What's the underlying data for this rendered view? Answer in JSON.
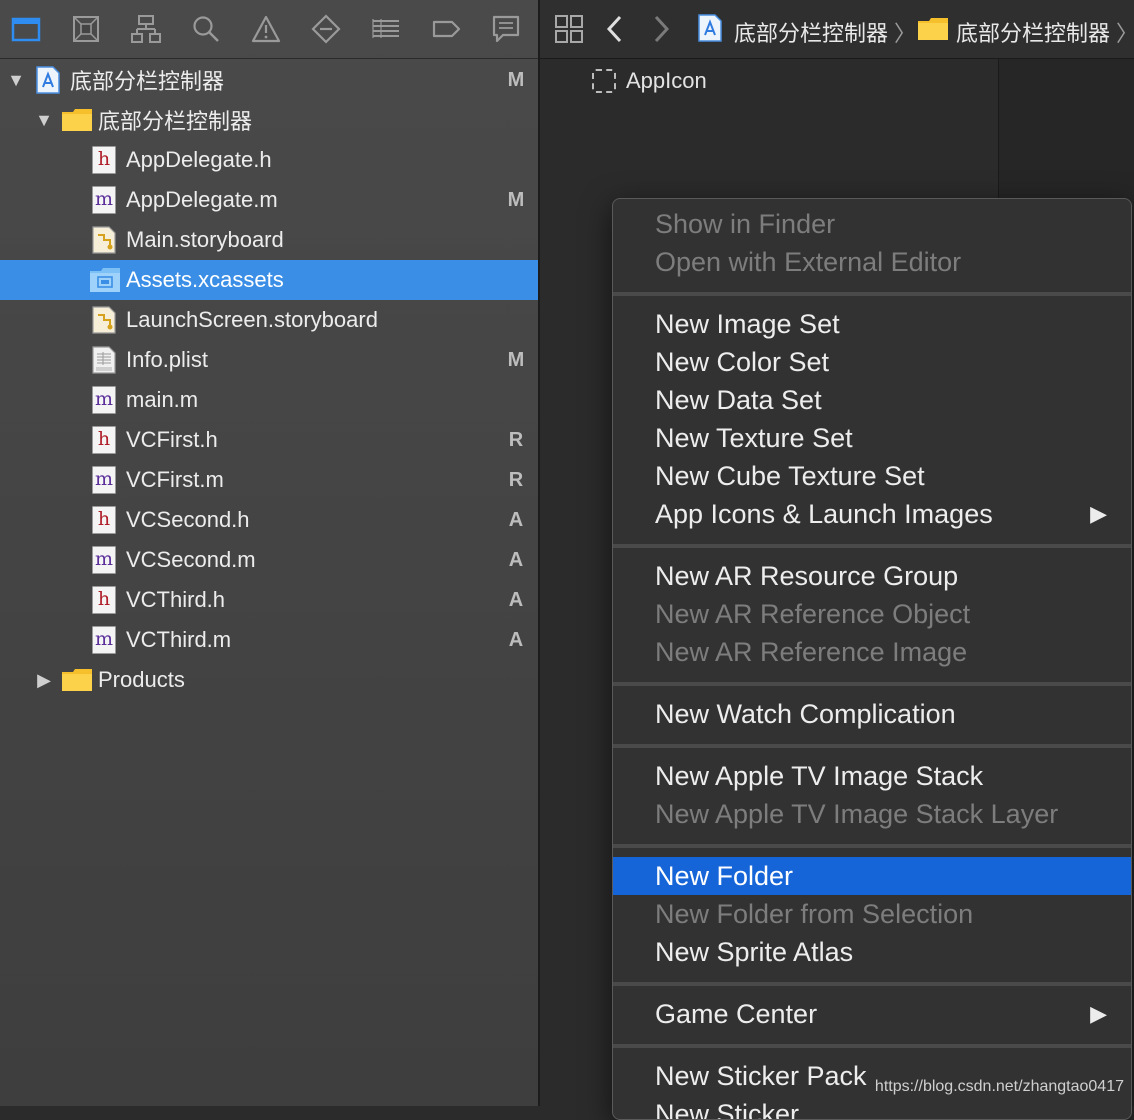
{
  "navigator": {
    "tools": [
      {
        "icon": "folder-icon",
        "active": true
      },
      {
        "icon": "source-control-icon"
      },
      {
        "icon": "hierarchy-icon"
      },
      {
        "icon": "search-icon"
      },
      {
        "icon": "warning-icon"
      },
      {
        "icon": "test-diamond-icon"
      },
      {
        "icon": "debug-list-icon"
      },
      {
        "icon": "breakpoint-icon"
      },
      {
        "icon": "report-icon"
      }
    ],
    "tree": [
      {
        "label": "底部分栏控制器",
        "type": "project",
        "status": "M"
      },
      {
        "label": "底部分栏控制器",
        "type": "group",
        "status": ""
      },
      {
        "label": "AppDelegate.h",
        "type": "h",
        "status": ""
      },
      {
        "label": "AppDelegate.m",
        "type": "m",
        "status": "M"
      },
      {
        "label": "Main.storyboard",
        "type": "storyboard",
        "status": ""
      },
      {
        "label": "Assets.xcassets",
        "type": "xcassets",
        "status": ""
      },
      {
        "label": "LaunchScreen.storyboard",
        "type": "storyboard",
        "status": ""
      },
      {
        "label": "Info.plist",
        "type": "plist",
        "status": "M"
      },
      {
        "label": "main.m",
        "type": "m",
        "status": ""
      },
      {
        "label": "VCFirst.h",
        "type": "h",
        "status": "R"
      },
      {
        "label": "VCFirst.m",
        "type": "m",
        "status": "R"
      },
      {
        "label": "VCSecond.h",
        "type": "h",
        "status": "A"
      },
      {
        "label": "VCSecond.m",
        "type": "m",
        "status": "A"
      },
      {
        "label": "VCThird.h",
        "type": "h",
        "status": "A"
      },
      {
        "label": "VCThird.m",
        "type": "m",
        "status": "A"
      },
      {
        "label": "Products",
        "type": "group",
        "status": ""
      }
    ],
    "selected_label": "Assets.xcassets"
  },
  "jumpbar": {
    "crumb1": "底部分栏控制器",
    "crumb2": "底部分栏控制器",
    "separator": "〉"
  },
  "asset_list": {
    "item": "AppIcon"
  },
  "context_menu": {
    "groups": [
      [
        {
          "label": "Show in Finder",
          "disabled": true
        },
        {
          "label": "Open with External Editor",
          "disabled": true
        }
      ],
      [
        {
          "label": "New Image Set"
        },
        {
          "label": "New Color Set"
        },
        {
          "label": "New Data Set"
        },
        {
          "label": "New Texture Set"
        },
        {
          "label": "New Cube Texture Set"
        },
        {
          "label": "App Icons & Launch Images",
          "submenu": true
        }
      ],
      [
        {
          "label": "New AR Resource Group"
        },
        {
          "label": "New AR Reference Object",
          "disabled": true
        },
        {
          "label": "New AR Reference Image",
          "disabled": true
        }
      ],
      [
        {
          "label": "New Watch Complication"
        }
      ],
      [
        {
          "label": "New Apple TV Image Stack"
        },
        {
          "label": "New Apple TV Image Stack Layer",
          "disabled": true
        }
      ],
      [
        {
          "label": "New Folder",
          "highlighted": true
        },
        {
          "label": "New Folder from Selection",
          "disabled": true
        },
        {
          "label": "New Sprite Atlas"
        }
      ],
      [
        {
          "label": "Game Center",
          "submenu": true
        }
      ],
      [
        {
          "label": "New Sticker Pack"
        },
        {
          "label": "New Sticker"
        }
      ]
    ],
    "submenu_arrow": "▶"
  },
  "watermark": "https://blog.csdn.net/zhangtao0417",
  "colors": {
    "selection": "#3a8ee6",
    "menu_highlight": "#1565d8",
    "folder_yellow": "#f5c02c",
    "toolbar_active": "#2f8cf0"
  }
}
